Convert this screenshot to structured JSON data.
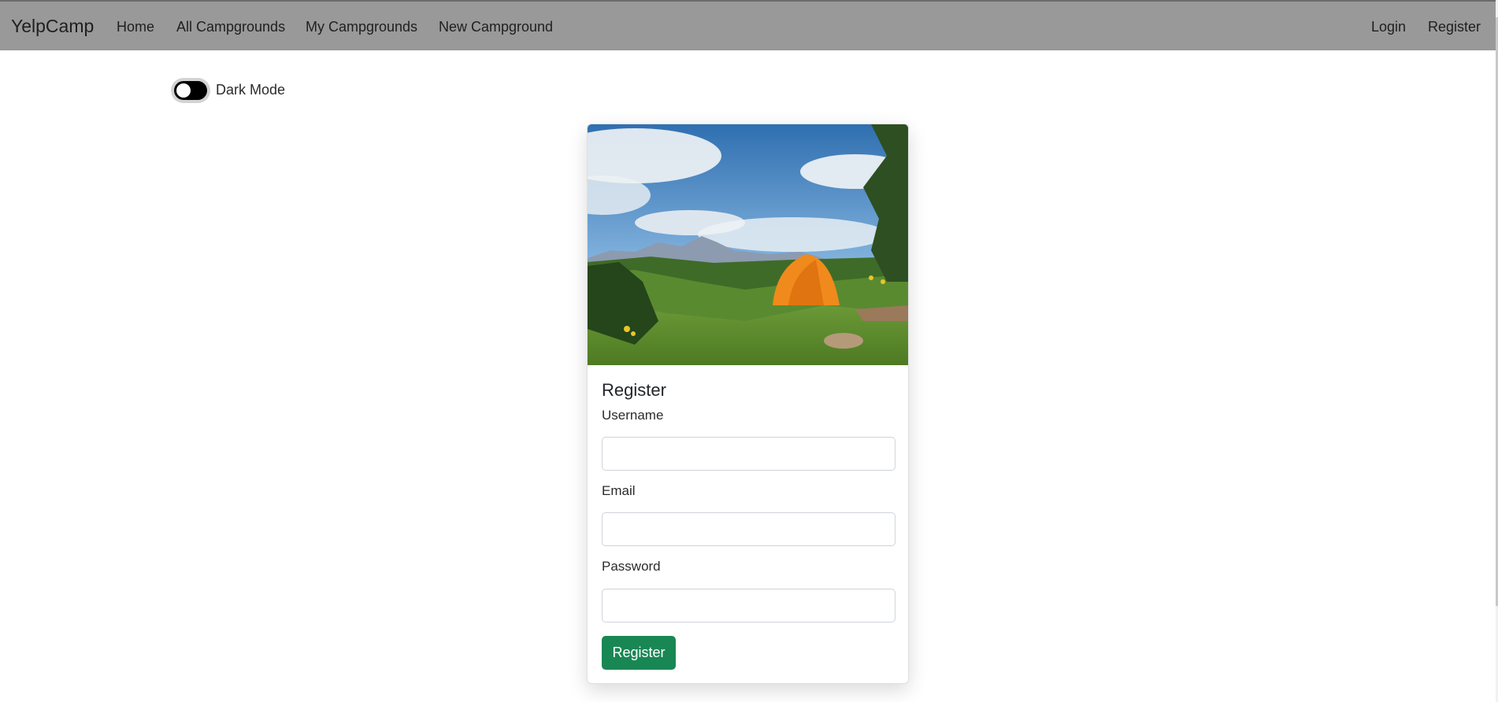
{
  "navbar": {
    "brand": "YelpCamp",
    "links": [
      {
        "label": "Home"
      },
      {
        "label": "All Campgrounds"
      },
      {
        "label": "My Campgrounds"
      },
      {
        "label": "New Campground"
      }
    ],
    "auth_links": [
      {
        "label": "Login"
      },
      {
        "label": "Register"
      }
    ]
  },
  "dark_mode": {
    "label": "Dark Mode",
    "enabled": false
  },
  "card": {
    "image_alt": "Orange tent on grassy hillside with mountains and blue sky",
    "title": "Register",
    "fields": [
      {
        "label": "Username",
        "value": "",
        "placeholder": "",
        "type": "text"
      },
      {
        "label": "Email",
        "value": "",
        "placeholder": "",
        "type": "email"
      },
      {
        "label": "Password",
        "value": "",
        "placeholder": "",
        "type": "password"
      }
    ],
    "submit_label": "Register"
  },
  "colors": {
    "navbar_bg": "#999999",
    "primary_button": "#198754"
  }
}
